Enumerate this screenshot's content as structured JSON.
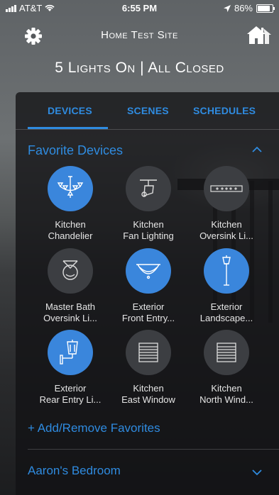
{
  "status": {
    "carrier": "AT&T",
    "time": "6:55 PM",
    "battery": "86%"
  },
  "header": {
    "site_title": "Home Test Site"
  },
  "summary": {
    "text": "5 Lights On | All Closed"
  },
  "tabs": [
    {
      "label": "DEVICES",
      "active": true
    },
    {
      "label": "SCENES",
      "active": false
    },
    {
      "label": "SCHEDULES",
      "active": false
    }
  ],
  "favorites": {
    "title": "Favorite Devices",
    "devices": [
      {
        "line1": "Kitchen",
        "line2": "Chandelier",
        "on": true,
        "icon": "chandelier-icon"
      },
      {
        "line1": "Kitchen",
        "line2": "Fan Lighting",
        "on": false,
        "icon": "track-light-icon"
      },
      {
        "line1": "Kitchen",
        "line2": "Oversink Li...",
        "on": false,
        "icon": "light-bar-icon"
      },
      {
        "line1": "Master Bath",
        "line2": "Oversink Li...",
        "on": false,
        "icon": "wall-sconce-icon"
      },
      {
        "line1": "Exterior",
        "line2": "Front Entry...",
        "on": true,
        "icon": "ceiling-bowl-icon"
      },
      {
        "line1": "Exterior",
        "line2": "Landscape...",
        "on": true,
        "icon": "lamp-post-icon"
      },
      {
        "line1": "Exterior",
        "line2": "Rear Entry Li...",
        "on": true,
        "icon": "wall-lantern-icon"
      },
      {
        "line1": "Kitchen",
        "line2": "East Window",
        "on": false,
        "icon": "window-shade-icon"
      },
      {
        "line1": "Kitchen",
        "line2": "North Wind...",
        "on": false,
        "icon": "window-shade-icon"
      }
    ],
    "add_label": "+ Add/Remove Favorites"
  },
  "rooms": [
    {
      "label": "Aaron's Bedroom"
    }
  ],
  "colors": {
    "accent": "#2f8be0",
    "on_circle": "#3a86dc",
    "off_circle": "#3c3e42"
  }
}
